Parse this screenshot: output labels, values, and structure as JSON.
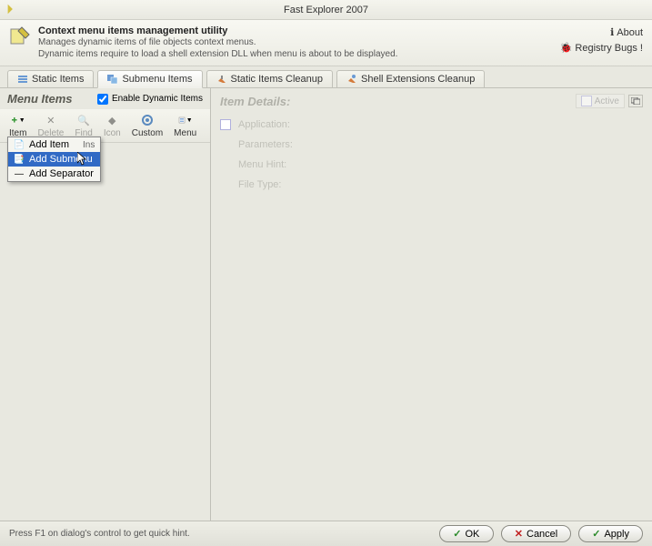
{
  "window": {
    "title": "Fast Explorer 2007"
  },
  "header": {
    "title": "Context menu items management utility",
    "line1": "Manages dynamic items of file objects context menus.",
    "line2": "Dynamic items require to load a shell extension DLL when menu is about to be displayed.",
    "about": "About",
    "bugs": "Registry Bugs !"
  },
  "tabs": {
    "static": "Static Items",
    "submenu": "Submenu Items",
    "cleanup": "Static Items Cleanup",
    "shell": "Shell Extensions Cleanup"
  },
  "left": {
    "title": "Menu Items",
    "enable": "Enable Dynamic Items",
    "toolbar": {
      "item": "Item",
      "delete": "Delete",
      "find": "Find",
      "icon": "Icon",
      "custom": "Custom",
      "menu": "Menu"
    },
    "dropdown": {
      "add_item": "Add Item",
      "add_item_shortcut": "Ins",
      "add_submenu": "Add Submenu",
      "add_separator": "Add Separator"
    }
  },
  "details": {
    "title": "Item Details:",
    "active": "Active",
    "application": "Application:",
    "parameters": "Parameters:",
    "menu_hint": "Menu Hint:",
    "file_type": "File Type:"
  },
  "footer": {
    "hint": "Press F1 on dialog's control to get quick hint.",
    "ok": "OK",
    "cancel": "Cancel",
    "apply": "Apply"
  }
}
